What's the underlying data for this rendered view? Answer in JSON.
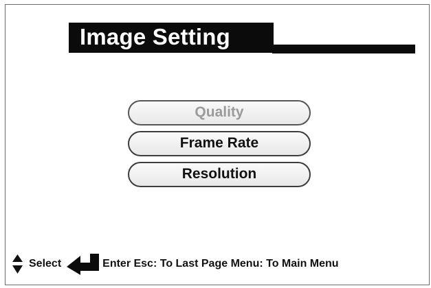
{
  "screen": {
    "title": "Image Setting"
  },
  "menu": {
    "items": [
      {
        "label": "Quality",
        "state": "disabled"
      },
      {
        "label": "Frame Rate",
        "state": "enabled"
      },
      {
        "label": "Resolution",
        "state": "enabled"
      }
    ]
  },
  "footer": {
    "select_label": "Select",
    "hint_label": "Enter Esc: To Last Page Menu: To Main Menu",
    "icons": [
      "up-down-arrows-icon",
      "enter-arrow-icon"
    ]
  },
  "colors": {
    "title_background": "#0b0b0b",
    "title_text": "#ffffff",
    "disabled_text": "#9a9a9a",
    "text": "#111111"
  }
}
